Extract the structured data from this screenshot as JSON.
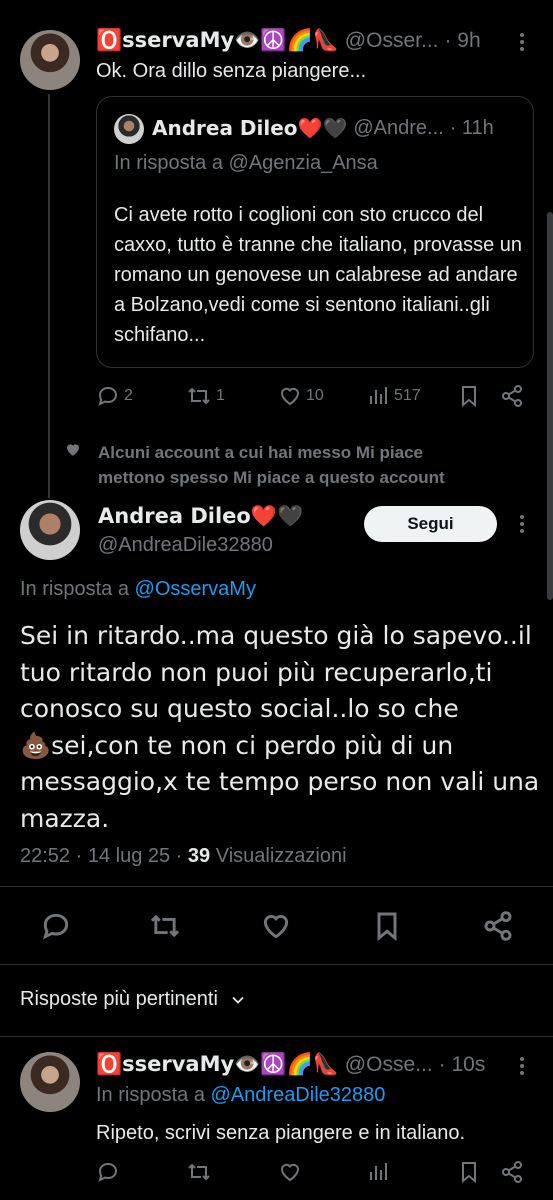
{
  "parent_tweet": {
    "display_name": "🅾️sservaMy👁️☮️🌈👠",
    "handle": "@Osser...",
    "time": "· 9h",
    "text": "Ok. Ora dillo senza piangere...",
    "quote": {
      "display_name": "Andrea Dileo❤️🖤",
      "handle": "@Andre...",
      "time": "· 11h",
      "reply_to_prefix": "In risposta a",
      "reply_to_handle": "@Agenzia_Ansa",
      "text": "Ci avete rotto i coglioni con sto crucco del caxxo, tutto è tranne che italiano, provasse un romano un genovese un calabrese ad andare a Bolzano,vedi come si sentono italiani..gli schifano..."
    },
    "actions": {
      "replies": "2",
      "retweets": "1",
      "likes": "10",
      "views": "517"
    }
  },
  "social_context": {
    "line1": "Alcuni account a cui hai messo Mi piace",
    "line2": "mettono spesso Mi piace a questo account"
  },
  "main_tweet": {
    "display_name": "Andrea Dileo❤️🖤",
    "handle": "@AndreaDile32880",
    "follow_label": "Segui",
    "reply_to_prefix": "In risposta a",
    "reply_to_handle": "@OsservaMy",
    "text_lines": [
      "Sei in ritardo..ma questo già lo sapevo..il",
      "tuo ritardo non puoi più recuperarlo,ti",
      "conosco su questo social..lo so che",
      "💩sei,con te non ci perdo più di un",
      "messaggio,x te tempo perso non vali una",
      "mazza."
    ],
    "timestamp": "22:52 · 14 lug 25 ·",
    "views_count": "39",
    "views_label": "Visualizzazioni"
  },
  "replies_section": {
    "sort_label": "Risposte più pertinenti"
  },
  "reply_tweet": {
    "display_name": "🅾️sservaMy👁️☮️🌈👠",
    "handle": "@Osse...",
    "time": "· 10s",
    "reply_to_prefix": "In risposta a",
    "reply_to_handle": "@AndreaDile32880",
    "text": "Ripeto, scrivi senza piangere e in italiano."
  },
  "icons": {
    "reply": "speech-bubble-icon",
    "retweet": "retweet-arrows-icon",
    "like": "heart-icon",
    "views": "bar-chart-icon",
    "bookmark": "bookmark-icon",
    "share": "share-nodes-icon",
    "more": "vertical-ellipsis-icon"
  },
  "colors": {
    "background": "#000000",
    "text": "#e7e9ea",
    "muted": "#71767b",
    "link": "#1d9bf0",
    "button": "#eff3f4"
  }
}
